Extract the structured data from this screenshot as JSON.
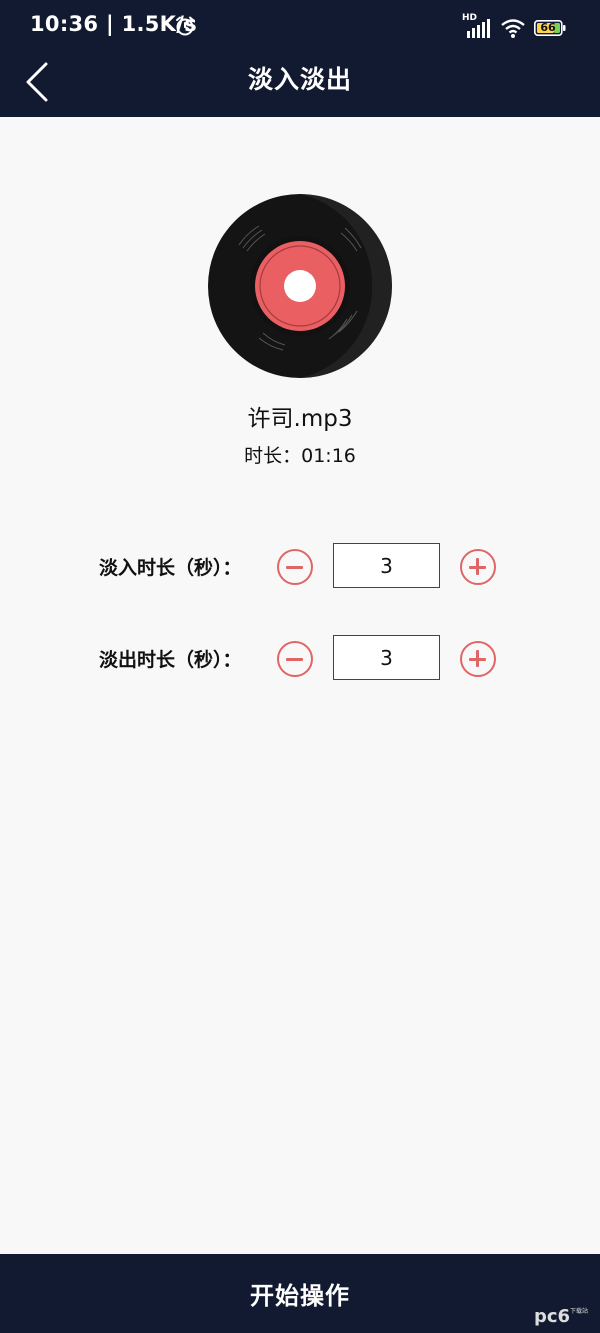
{
  "status_bar": {
    "time": "10:36",
    "net_speed": "1.5K/s",
    "hd_label": "HD",
    "battery": "66"
  },
  "header": {
    "title": "淡入淡出"
  },
  "track": {
    "filename": "许司.mp3",
    "duration": "时长：01:16"
  },
  "settings": {
    "fade_in": {
      "label": "淡入时长（秒）：",
      "value": "3"
    },
    "fade_out": {
      "label": "淡出时长（秒）：",
      "value": "3"
    }
  },
  "footer": {
    "start_label": "开始操作"
  },
  "watermark": {
    "brand": "pc6",
    "sub": "下载站"
  },
  "icons": {
    "back": "chevron-left-icon",
    "alarm": "alarm-clock-icon",
    "signal": "signal-icon",
    "wifi": "wifi-icon",
    "battery": "battery-icon",
    "disc": "vinyl-record-icon",
    "minus": "minus-circle-icon",
    "plus": "plus-circle-icon"
  },
  "colors": {
    "bar_bg": "#111a30",
    "accent": "#e06666",
    "page_bg": "#f8f8f8"
  }
}
